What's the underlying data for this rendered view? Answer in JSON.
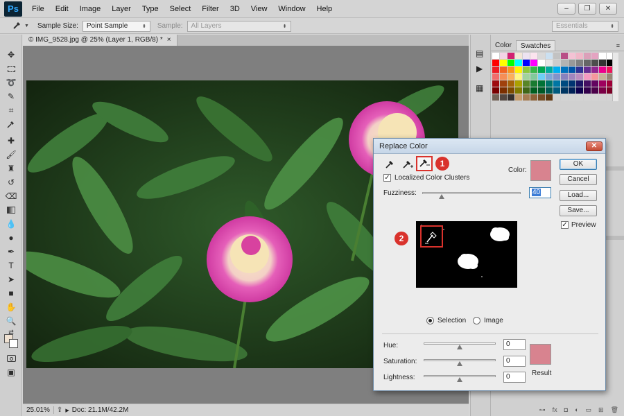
{
  "app": {
    "logo": "Ps"
  },
  "menu": [
    "File",
    "Edit",
    "Image",
    "Layer",
    "Type",
    "Select",
    "Filter",
    "3D",
    "View",
    "Window",
    "Help"
  ],
  "window_controls": {
    "minimize": "–",
    "restore": "❐",
    "close": "✕"
  },
  "options_bar": {
    "sample_size_label": "Sample Size:",
    "sample_size_value": "Point Sample",
    "sample_label": "Sample:",
    "sample_value": "All Layers",
    "workspace_value": "Essentials"
  },
  "document": {
    "tab_title": "© IMG_9528.jpg @ 25% (Layer 1, RGB/8) *",
    "tab_close": "×",
    "zoom": "25.01%",
    "doc_info": "Doc: 21.1M/42.2M"
  },
  "panels": {
    "tabs": [
      "Color",
      "Swatches"
    ],
    "active_tab": "Swatches"
  },
  "swatch_colors": [
    "#ffffff",
    "#f3d3e6",
    "#d21f71",
    "#f3e6d7",
    "#ede3f1",
    "#fbe4ee",
    "#d9d9d9",
    "#cbe0f1",
    "#c2c2c2",
    "#b94f86",
    "#f4c2d4",
    "#f0b7c8",
    "#dba0b9",
    "#e4a3c1",
    "#ffffff",
    "#ffffff",
    "#ff0000",
    "#ffff00",
    "#00ff00",
    "#00ffff",
    "#0000ff",
    "#ff00ff",
    "#ffffff",
    "#e6e6e6",
    "#cccccc",
    "#b3b3b3",
    "#999999",
    "#808080",
    "#666666",
    "#4d4d4d",
    "#333333",
    "#000000",
    "#ee1c24",
    "#f16522",
    "#f7941d",
    "#fff200",
    "#8dc63f",
    "#39b54a",
    "#00a651",
    "#00a99d",
    "#00aeef",
    "#0072bc",
    "#0054a6",
    "#2e3192",
    "#662d91",
    "#92278f",
    "#ec008c",
    "#ed145b",
    "#f26c6c",
    "#f68e56",
    "#fbaf5d",
    "#fff685",
    "#a2d39c",
    "#82ca9c",
    "#6dcff6",
    "#7da7d9",
    "#8393ca",
    "#8882be",
    "#a186be",
    "#bc8dbf",
    "#f49ac1",
    "#f6989d",
    "#c7b299",
    "#998675",
    "#9e0b0f",
    "#a0410d",
    "#a3620a",
    "#aba000",
    "#598527",
    "#197b30",
    "#007236",
    "#00746b",
    "#0076a3",
    "#004a80",
    "#003471",
    "#1b1464",
    "#440e62",
    "#630460",
    "#9e005d",
    "#9e0039",
    "#790000",
    "#7b2e00",
    "#7d4900",
    "#827b00",
    "#406618",
    "#005e20",
    "#005826",
    "#005952",
    "#005b7f",
    "#003663",
    "#002157",
    "#0d004c",
    "#32004b",
    "#4b0049",
    "#7b0046",
    "#7a0026",
    "#736357",
    "#534741",
    "#362f2d",
    "#c69c6d",
    "#a67c52",
    "#8c6239",
    "#754c24",
    "#603913",
    "#d4d4d4",
    "#d4d4d4",
    "#d4d4d4",
    "#d4d4d4",
    "#d4d4d4",
    "#d4d4d4",
    "#d4d4d4",
    "#d4d4d4"
  ],
  "dialog": {
    "title": "Replace Color",
    "close_symbol": "✕",
    "localized_label": "Localized Color Clusters",
    "localized_checked": true,
    "color_label": "Color:",
    "sampled_color": "#d8838f",
    "fuzziness_label": "Fuzziness:",
    "fuzziness_value": "40",
    "fuzziness_level_fraction": 0.2,
    "buttons": {
      "ok": "OK",
      "cancel": "Cancel",
      "load": "Load...",
      "save": "Save..."
    },
    "preview_label": "Preview",
    "preview_checked": true,
    "mode_selection": "Selection",
    "mode_image": "Image",
    "selected_mode": "Selection",
    "hue_label": "Hue:",
    "hue_value": "0",
    "saturation_label": "Saturation:",
    "saturation_value": "0",
    "lightness_label": "Lightness:",
    "lightness_value": "0",
    "result_label": "Result",
    "result_color": "#d8838f",
    "badge_1": "1",
    "badge_2": "2"
  }
}
